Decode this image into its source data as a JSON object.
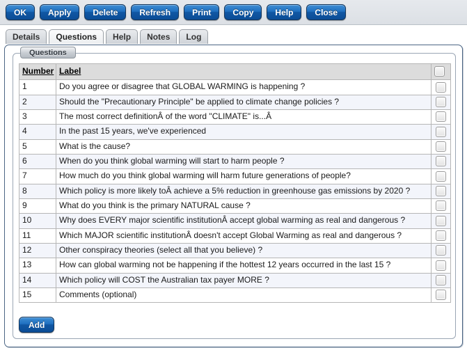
{
  "toolbar": {
    "buttons": [
      {
        "label": "OK",
        "name": "ok-button"
      },
      {
        "label": "Apply",
        "name": "apply-button"
      },
      {
        "label": "Delete",
        "name": "delete-button"
      },
      {
        "label": "Refresh",
        "name": "refresh-button"
      },
      {
        "label": "Print",
        "name": "print-button"
      },
      {
        "label": "Copy",
        "name": "copy-button"
      },
      {
        "label": "Help",
        "name": "help-button"
      },
      {
        "label": "Close",
        "name": "close-button"
      }
    ]
  },
  "tabs": [
    {
      "label": "Details",
      "active": false
    },
    {
      "label": "Questions",
      "active": true
    },
    {
      "label": "Help",
      "active": false
    },
    {
      "label": "Notes",
      "active": false
    },
    {
      "label": "Log",
      "active": false
    }
  ],
  "fieldset": {
    "legend": "Questions"
  },
  "table": {
    "columns": [
      "Number",
      "Label",
      ""
    ],
    "rows": [
      {
        "number": "1",
        "label": "Do you agree or disagree that GLOBAL WARMING is happening ?"
      },
      {
        "number": "2",
        "label": "Should the \"Precautionary Principle\" be applied to climate change policies ?"
      },
      {
        "number": "3",
        "label": "The most correct definitionÂ of the word \"CLIMATE\" is...Â"
      },
      {
        "number": "4",
        "label": "In the past 15 years, we've experienced"
      },
      {
        "number": "5",
        "label": "What is the cause?"
      },
      {
        "number": "6",
        "label": "When do you think global warming will start to harm people ?"
      },
      {
        "number": "7",
        "label": "How much do you think global warming will harm future generations of people?"
      },
      {
        "number": "8",
        "label": "Which policy is more likely toÂ achieve a 5% reduction in greenhouse gas emissions by 2020 ?"
      },
      {
        "number": "9",
        "label": "What do you think is the primary NATURAL cause ?"
      },
      {
        "number": "10",
        "label": "Why does EVERY major scientific institutionÂ accept global warming as real and dangerous ?"
      },
      {
        "number": "11",
        "label": "Which MAJOR scientific institutionÂ doesn't accept Global Warming as real and dangerous ?"
      },
      {
        "number": "12",
        "label": "Other conspiracy theories (select all that you believe) ?"
      },
      {
        "number": "13",
        "label": "How can global warming not be happening if the hottest 12 years occurred in the last 15 ?"
      },
      {
        "number": "14",
        "label": "Which policy will COST the Australian tax payer MORE ?"
      },
      {
        "number": "15",
        "label": "Comments (optional)"
      }
    ]
  },
  "actions": {
    "add_label": "Add"
  },
  "colors": {
    "button_blue": "#1157a4",
    "toolbar_bg": "#dfe3e8",
    "panel_border": "#4b6584",
    "header_bg": "#dcdcdc",
    "row_alt_bg": "#f3f5fb"
  }
}
